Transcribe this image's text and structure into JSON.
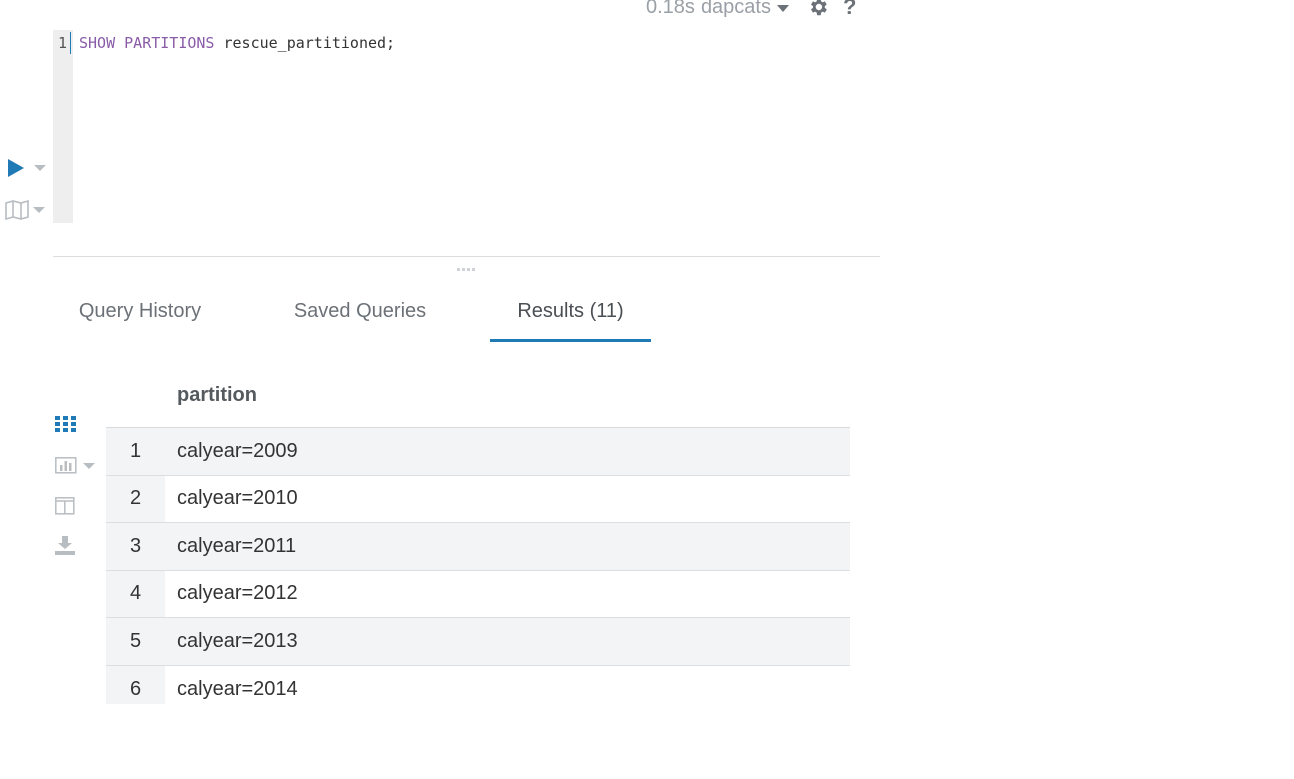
{
  "status": {
    "exec_time": "0.18s",
    "database": "dapcats"
  },
  "editor": {
    "line_number": "1",
    "keyword": "SHOW PARTITIONS",
    "table_name": "rescue_partitioned;"
  },
  "tabs": [
    {
      "label": "Query History"
    },
    {
      "label": "Saved Queries"
    },
    {
      "label": "Results (11)"
    }
  ],
  "results": {
    "column": "partition",
    "rows": [
      {
        "num": "1",
        "value": "calyear=2009"
      },
      {
        "num": "2",
        "value": "calyear=2010"
      },
      {
        "num": "3",
        "value": "calyear=2011"
      },
      {
        "num": "4",
        "value": "calyear=2012"
      },
      {
        "num": "5",
        "value": "calyear=2013"
      },
      {
        "num": "6",
        "value": "calyear=2014"
      }
    ]
  },
  "colors": {
    "accent": "#1f7ab6",
    "active_tab": "Results (11)"
  },
  "icons": [
    "execute-play-icon",
    "map-icon",
    "settings-gear-icon",
    "help-icon",
    "grid-view-icon",
    "chart-view-icon",
    "column-panel-icon",
    "download-icon"
  ]
}
